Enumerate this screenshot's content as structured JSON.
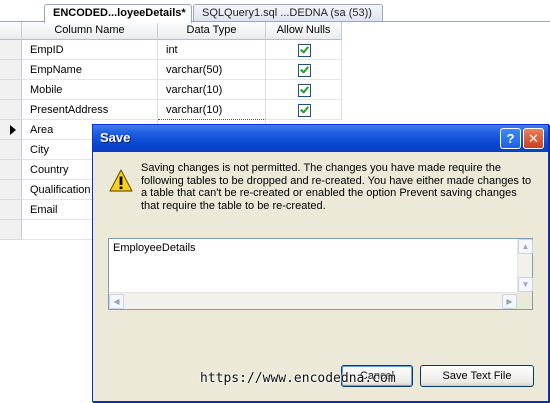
{
  "tabs": {
    "active": "ENCODED...loyeeDetails*",
    "inactive": "SQLQuery1.sql ...DEDNA (sa (53))"
  },
  "grid": {
    "headers": [
      "Column Name",
      "Data Type",
      "Allow Nulls"
    ],
    "rows": [
      {
        "name": "EmpID",
        "type": "int",
        "allow_nulls": true
      },
      {
        "name": "EmpName",
        "type": "varchar(50)",
        "allow_nulls": true
      },
      {
        "name": "Mobile",
        "type": "varchar(10)",
        "allow_nulls": true
      },
      {
        "name": "PresentAddress",
        "type": "varchar(10)",
        "allow_nulls": true
      },
      {
        "name": "Area",
        "type": "",
        "allow_nulls": false
      },
      {
        "name": "City",
        "type": "",
        "allow_nulls": false
      },
      {
        "name": "Country",
        "type": "",
        "allow_nulls": false
      },
      {
        "name": "Qualification",
        "type": "",
        "allow_nulls": false
      },
      {
        "name": "Email",
        "type": "",
        "allow_nulls": false
      },
      {
        "name": "",
        "type": "",
        "allow_nulls": false
      }
    ],
    "current_row_index": 4
  },
  "dialog": {
    "title": "Save",
    "help_glyph": "?",
    "close_glyph": "✕",
    "icon": "warning-icon",
    "message": "Saving changes is not permitted. The changes you have made require the following tables to be dropped and re-created. You have either made changes to a table that can't be re-created or enabled the option Prevent saving changes that require the table to be re-created.",
    "tables": [
      "EmployeeDetails"
    ],
    "cancel_label": "Cancel",
    "save_text_label": "Save Text File"
  },
  "watermark": "https://www.encodedna.com",
  "colors": {
    "titlebar": "#0a47d2",
    "dialog_bg": "#ece9d8",
    "checkmark": "#21a121"
  }
}
